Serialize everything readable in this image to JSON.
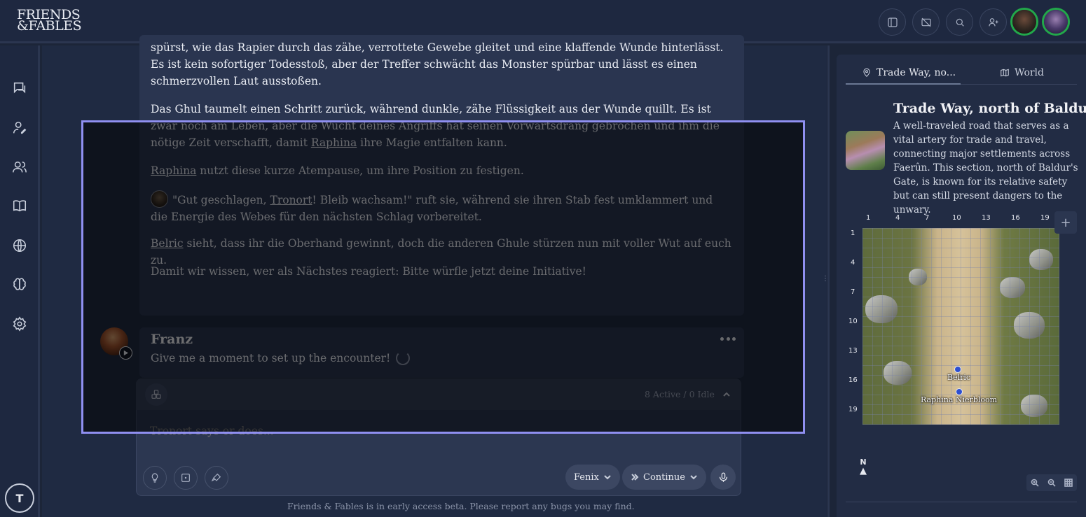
{
  "app": {
    "logo_line1": "FRIENDS",
    "logo_line2": "&FABLES"
  },
  "topbar": {
    "buttons": [
      "panel-icon",
      "camera-off-icon",
      "search-icon",
      "user-plus-icon"
    ],
    "avatars": [
      "player-avatar-1",
      "player-avatar-2"
    ]
  },
  "sidebar": {
    "items": [
      "chat-icon",
      "character-icon",
      "party-icon",
      "book-icon",
      "globe-icon",
      "brain-icon",
      "settings-icon"
    ],
    "user_initial": "T"
  },
  "story": {
    "p1": "spürst, wie das Rapier durch das zähe, verrottete Gewebe gleitet und eine klaffende Wunde hinterlässt. Es ist kein sofortiger Todesstoß, aber der Treffer schwächt das Monster spürbar und lässt es einen schmerzvollen Laut ausstoßen.",
    "p2_a": "Das Ghul taumelt einen Schritt zurück, während dunkle, zähe Flüssigkeit aus der Wunde quillt. Es ist zwar noch am Leben, aber die Wucht deines Angriffs hat seinen Vorwärtsdrang gebrochen und ihm die nötige Zeit verschafft, damit ",
    "p2_link": "Raphina",
    "p2_b": " ihre Magie entfalten kann.",
    "p3_link": "Raphina",
    "p3_b": " nutzt diese kurze Atempause, um ihre Position zu festigen.",
    "p4_a": "\"Gut geschlagen, ",
    "p4_link": "Tronort",
    "p4_b": "! Bleib wachsam!\"  ruft sie, während sie ihren Stab fest umklammert und die Energie des Webes für den nächsten Schlag vorbereitet.",
    "p5_link": "Belric",
    "p5_b": " sieht, dass ihr die Oberhand gewinnt, doch die anderen Ghule stürzen nun mit voller Wut auf euch zu.",
    "p6": "Damit wir wissen, wer als Nächstes reagiert: Bitte würfle jetzt deine Initiative!"
  },
  "franz": {
    "name": "Franz",
    "text": "Give me a moment to set up the encounter!"
  },
  "composer": {
    "status": "8 Active / 0 Idle",
    "placeholder": "Tronort says or does...",
    "model_label": "Fenix",
    "mode_label": "Continue"
  },
  "footer": {
    "note": "Friends & Fables is in early access beta. Please report any bugs you may find."
  },
  "panel": {
    "tab_location": "Trade Way, no...",
    "tab_world": "World",
    "location_title": "Trade Way, north of Baldur'...",
    "location_desc": "A well-traveled road that serves as a vital artery for trade and travel, connecting major settlements across Faerûn. This section, north of Baldur's Gate, is known for its relative safety but can still present dangers to the unwary.",
    "grid_cols": [
      "1",
      "4",
      "7",
      "10",
      "13",
      "16",
      "19"
    ],
    "grid_rows": [
      "1",
      "4",
      "7",
      "10",
      "13",
      "16",
      "19"
    ],
    "tokens": [
      {
        "label": "Belric"
      },
      {
        "label": "Raphina Nierbloom"
      }
    ],
    "compass": "N"
  }
}
